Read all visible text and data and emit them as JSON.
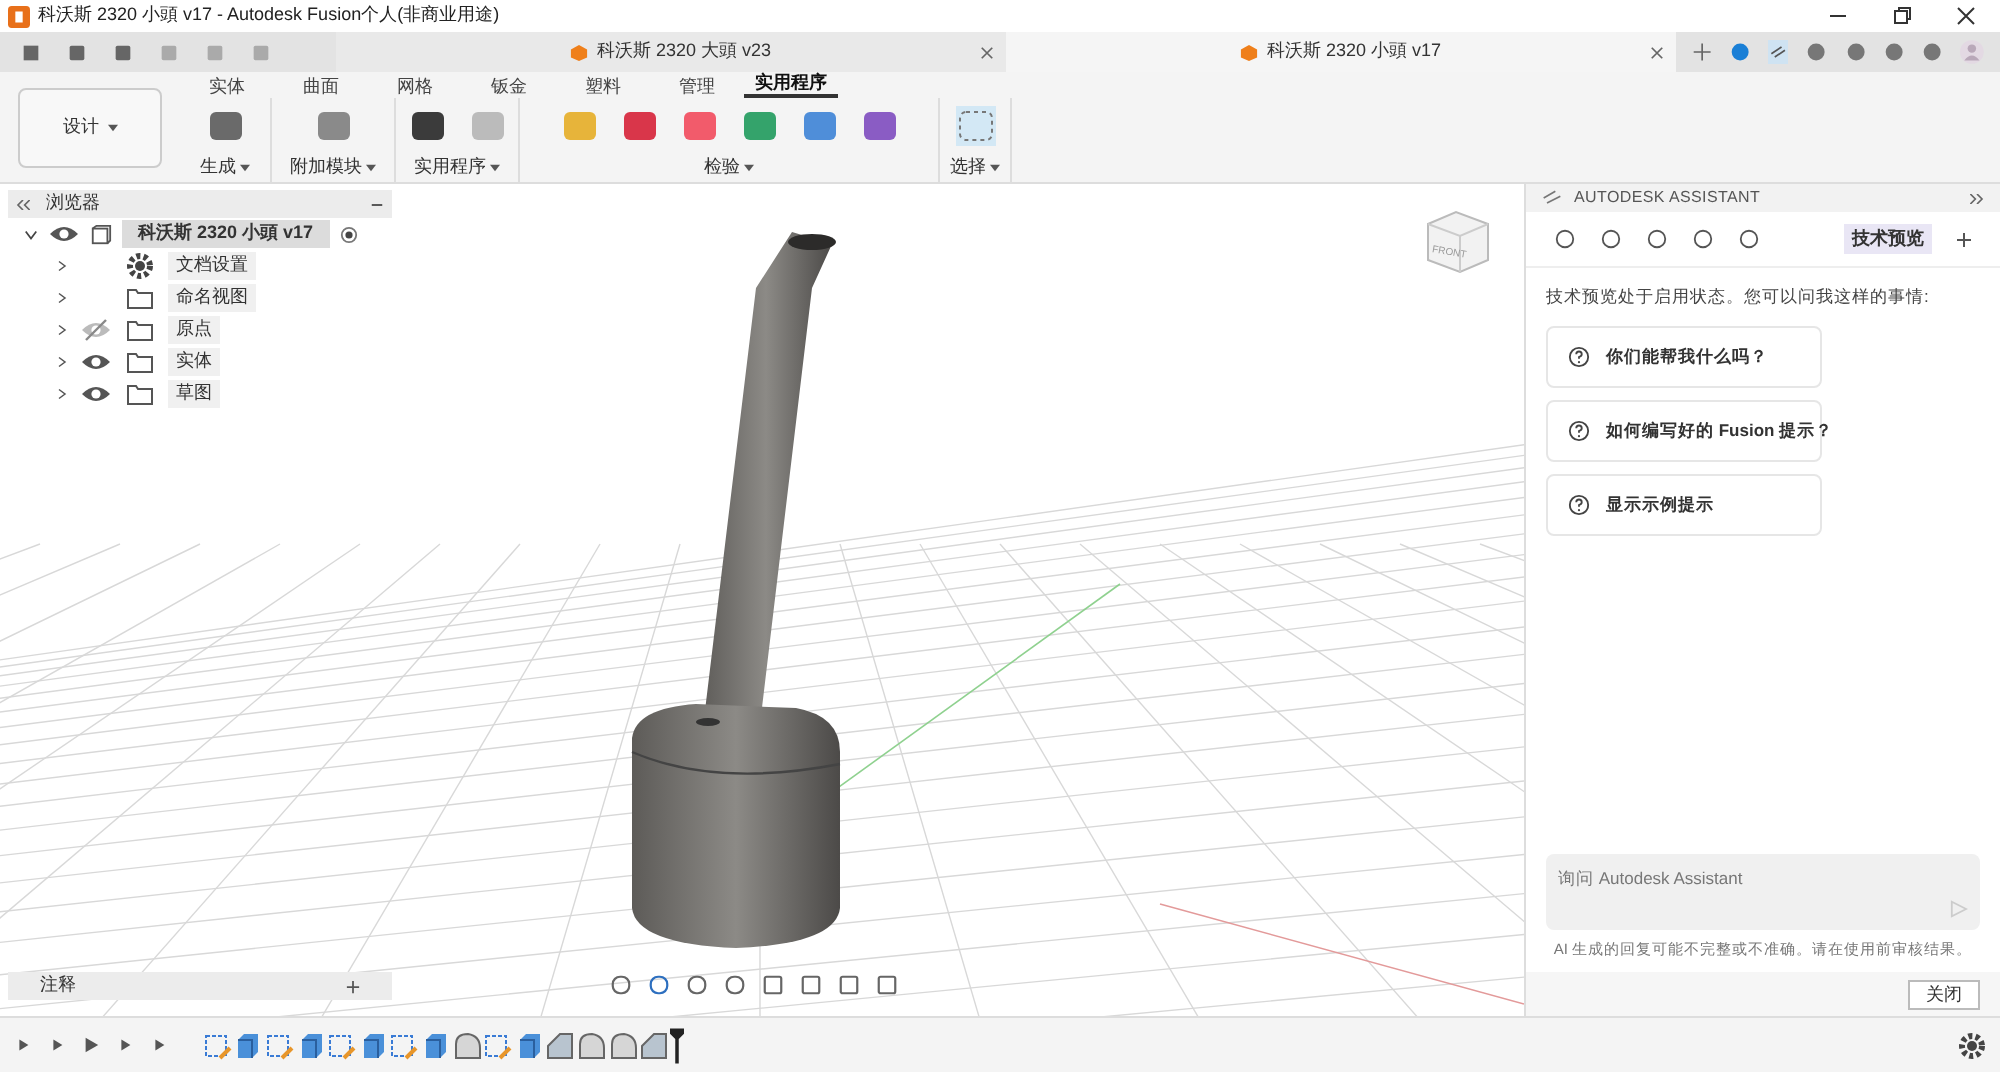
{
  "window": {
    "title": "科沃斯 2320 小頭 v17 - Autodesk Fusion个人(非商业用途)"
  },
  "doc_tabs": [
    {
      "label": "科沃斯 2320 大頭 v23",
      "selected": false
    },
    {
      "label": "科沃斯 2320 小頭 v17",
      "selected": true
    }
  ],
  "ribbon": {
    "workspace": "设计",
    "tabs": [
      {
        "label": "实体",
        "selected": false
      },
      {
        "label": "曲面",
        "selected": false
      },
      {
        "label": "网格",
        "selected": false
      },
      {
        "label": "钣金",
        "selected": false
      },
      {
        "label": "塑料",
        "selected": false
      },
      {
        "label": "管理",
        "selected": false
      },
      {
        "label": "实用程序",
        "selected": true
      }
    ],
    "groups": [
      "生成",
      "附加模块",
      "实用程序",
      "检验",
      "选择"
    ]
  },
  "browser": {
    "title": "浏览器",
    "root": {
      "label": "科沃斯 2320 小頭 v17",
      "expanded": true,
      "children": [
        {
          "label": "文档设置",
          "kind": "gear"
        },
        {
          "label": "命名视图",
          "kind": "folder"
        },
        {
          "label": "原点",
          "kind": "folder",
          "visible": false
        },
        {
          "label": "实体",
          "kind": "folder",
          "visible": true
        },
        {
          "label": "草图",
          "kind": "folder",
          "visible": true
        }
      ]
    }
  },
  "viewcube": {
    "face": "FRONT"
  },
  "comments": {
    "title": "注释"
  },
  "assistant": {
    "title": "AUTODESK ASSISTANT",
    "badge": "技术预览",
    "intro": "技术预览处于启用状态。您可以问我这样的事情:",
    "suggestions": [
      "你们能帮我什么吗？",
      "如何编写好的 Fusion 提示？",
      "显示示例提示"
    ],
    "input": {
      "placeholder": "询问 Autodesk Assistant"
    },
    "disclaimer": "AI 生成的回复可能不完整或不准确。请在使用前审核结果。",
    "close": "关闭"
  },
  "timeline": [
    {
      "kind": "sketch"
    },
    {
      "kind": "extrude"
    },
    {
      "kind": "sketch"
    },
    {
      "kind": "extrude"
    },
    {
      "kind": "sketch"
    },
    {
      "kind": "extrude"
    },
    {
      "kind": "sketch"
    },
    {
      "kind": "extrude"
    },
    {
      "kind": "fillet"
    },
    {
      "kind": "sketch"
    },
    {
      "kind": "extrude"
    },
    {
      "kind": "chamfer"
    },
    {
      "kind": "fillet"
    },
    {
      "kind": "fillet"
    },
    {
      "kind": "chamfer"
    }
  ]
}
